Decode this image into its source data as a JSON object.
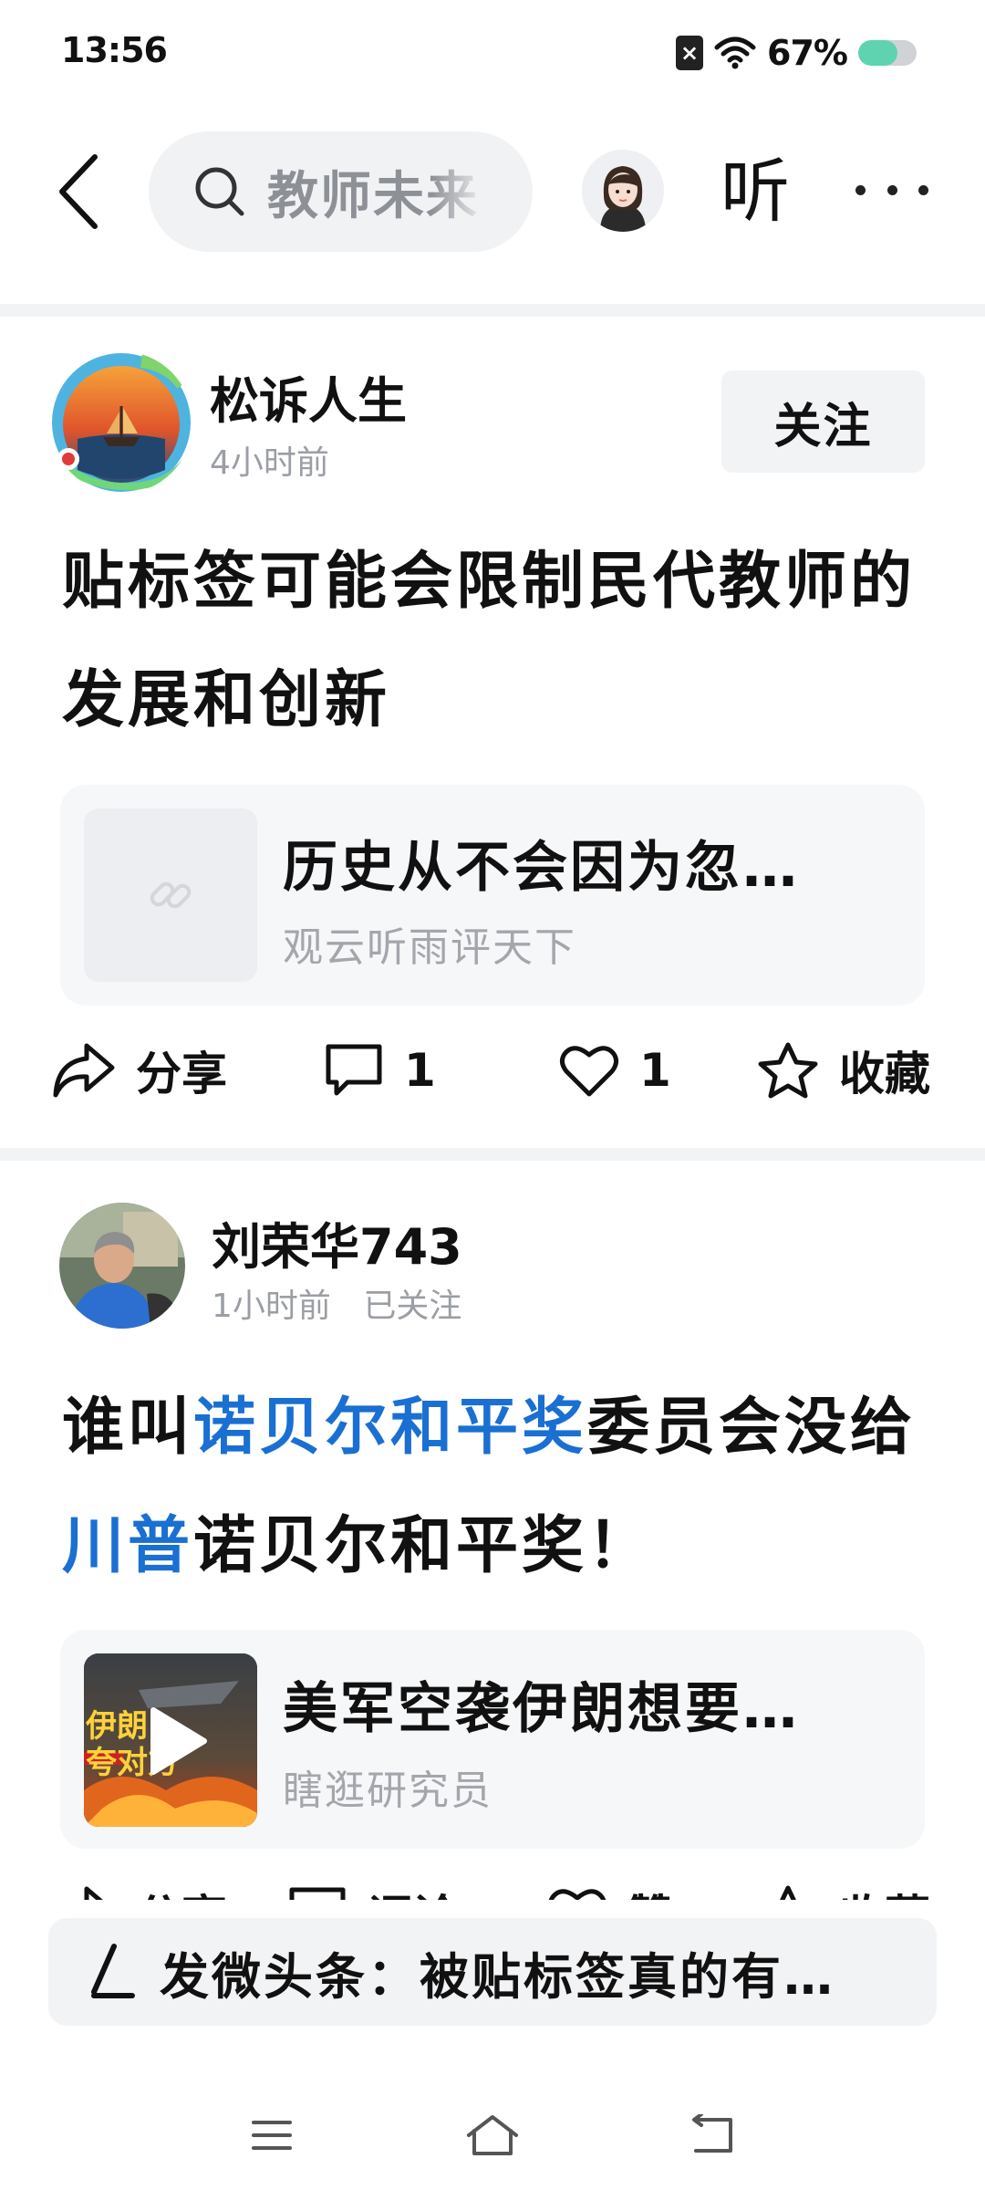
{
  "status_bar": {
    "time": "13:56",
    "sim_icon": "sim-x-icon",
    "battery_percent_label": "67%",
    "battery_level": 0.67,
    "battery_color": "#5fd3b0"
  },
  "nav": {
    "search_text": "教师未来",
    "listen_label": "听"
  },
  "posts": [
    {
      "author": "松诉人生",
      "meta": "4小时前",
      "follow_label": "关注",
      "title": "贴标签可能会限制民代教师的发展和创新",
      "link": {
        "title": "历史从不会因为忽…",
        "source": "观云听雨评天下"
      },
      "actions": {
        "share": "分享",
        "comments": "1",
        "likes": "1",
        "favorite": "收藏"
      }
    },
    {
      "author": "刘荣华743",
      "meta_time": "1小时前",
      "meta_status": "已关注",
      "title_parts": [
        "谁叫",
        "诺贝尔和平奖",
        "委员会没给",
        "川普",
        "诺贝尔和平奖！"
      ],
      "link": {
        "title": "美军空袭伊朗想要…",
        "source": "瞎逛研究员",
        "thumb_text_1": "伊朗",
        "thumb_text_2": "夸对方"
      },
      "actions": {
        "share": "分享",
        "comment": "评论",
        "like": "赞",
        "favorite": "收藏"
      }
    }
  ],
  "compose": {
    "text": "发微头条：被贴标签真的有…"
  },
  "accent_color": "#1a6fd2"
}
